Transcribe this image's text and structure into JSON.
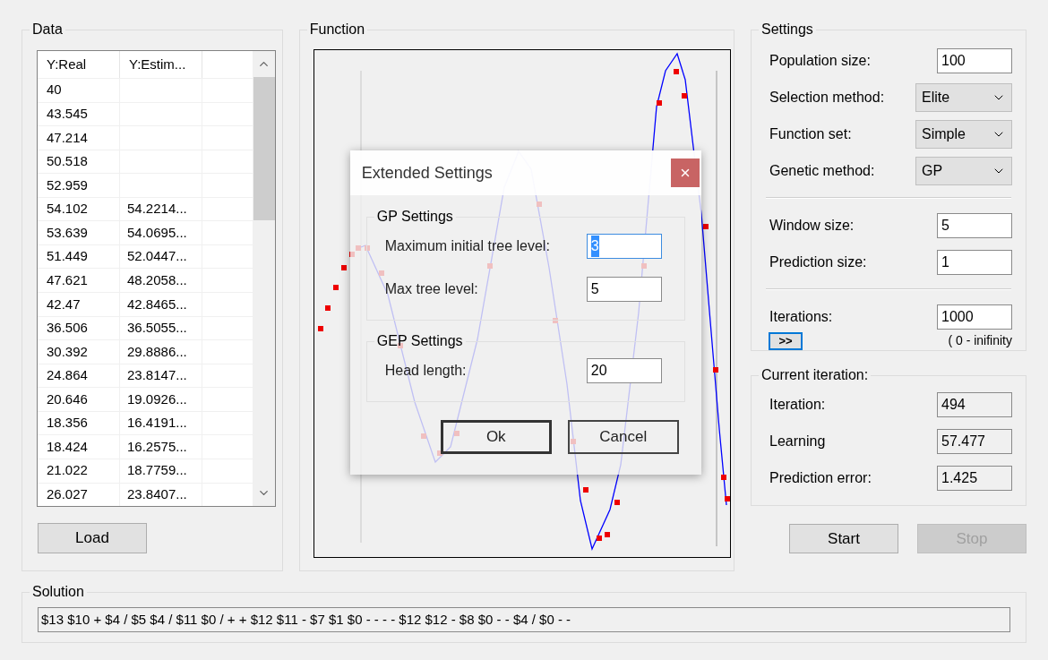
{
  "data_panel": {
    "title": "Data",
    "columns": [
      "Y:Real",
      "Y:Estim..."
    ],
    "rows": [
      {
        "real": "40"
      },
      {
        "real": "43.545"
      },
      {
        "real": "47.214"
      },
      {
        "real": "50.518"
      },
      {
        "real": "52.959"
      },
      {
        "real": "54.102",
        "estimated": "54.2214..."
      },
      {
        "real": "53.639",
        "estimated": "54.0695..."
      },
      {
        "real": "51.449",
        "estimated": "52.0447..."
      },
      {
        "real": "47.621",
        "estimated": "48.2058..."
      },
      {
        "real": "42.47",
        "estimated": "42.8465..."
      },
      {
        "real": "36.506",
        "estimated": "36.5055..."
      },
      {
        "real": "30.392",
        "estimated": "29.8886..."
      },
      {
        "real": "24.864",
        "estimated": "23.8147..."
      },
      {
        "real": "20.646",
        "estimated": "19.0926..."
      },
      {
        "real": "18.356",
        "estimated": "16.4191..."
      },
      {
        "real": "18.424",
        "estimated": "16.2575..."
      },
      {
        "real": "21.022",
        "estimated": "18.7759..."
      },
      {
        "real": "26.027",
        "estimated": "23.8407..."
      }
    ],
    "load_button": "Load"
  },
  "function_panel": {
    "title": "Function"
  },
  "settings": {
    "title": "Settings",
    "sections": [
      [
        {
          "kind": "text",
          "label": "Population size:",
          "value": "100"
        },
        {
          "kind": "dropdown",
          "label": "Selection method:",
          "value": "Elite"
        },
        {
          "kind": "dropdown",
          "label": "Function set:",
          "value": "Simple"
        },
        {
          "kind": "dropdown",
          "label": "Genetic method:",
          "value": "GP"
        }
      ],
      [
        {
          "kind": "text",
          "label": "Window size:",
          "value": "5"
        },
        {
          "kind": "text",
          "label": "Prediction size:",
          "value": "1"
        }
      ],
      [
        {
          "kind": "text",
          "label": "Iterations:",
          "value": "1000"
        }
      ]
    ],
    "more_button": {
      "label": ">>",
      "highlighted": true
    },
    "hint": "( 0 - inifinity"
  },
  "current_iteration": {
    "title": "Current iteration:",
    "fields": [
      {
        "label": "Iteration:",
        "value": "494"
      },
      {
        "label": "Learning",
        "value": "57.477"
      },
      {
        "label": "Prediction error:",
        "value": "1.425"
      }
    ]
  },
  "buttons": [
    {
      "label": "Start",
      "disabled": false
    },
    {
      "label": "Stop",
      "disabled": true
    }
  ],
  "solution": {
    "title": "Solution",
    "value": "$13 $10 + $4 / $5 $4 / $11 $0 / + + $12 $11 - $7 $1 $0 - - - - $12 $12 - $8 $0 - - $4 / $0 - -"
  },
  "dialog": {
    "title": "Extended Settings",
    "groups": [
      {
        "title": "GP Settings",
        "fields": [
          {
            "label": "Maximum initial tree level:",
            "value": "3",
            "focused": true
          },
          {
            "label": "Max tree level:",
            "value": "5",
            "focused": false
          }
        ]
      },
      {
        "title": "GEP Settings",
        "fields": [
          {
            "label": "Head length:",
            "value": "20",
            "focused": false
          }
        ]
      }
    ],
    "buttons": [
      {
        "label": "Ok",
        "default": true
      },
      {
        "label": "Cancel",
        "default": false
      }
    ]
  }
}
